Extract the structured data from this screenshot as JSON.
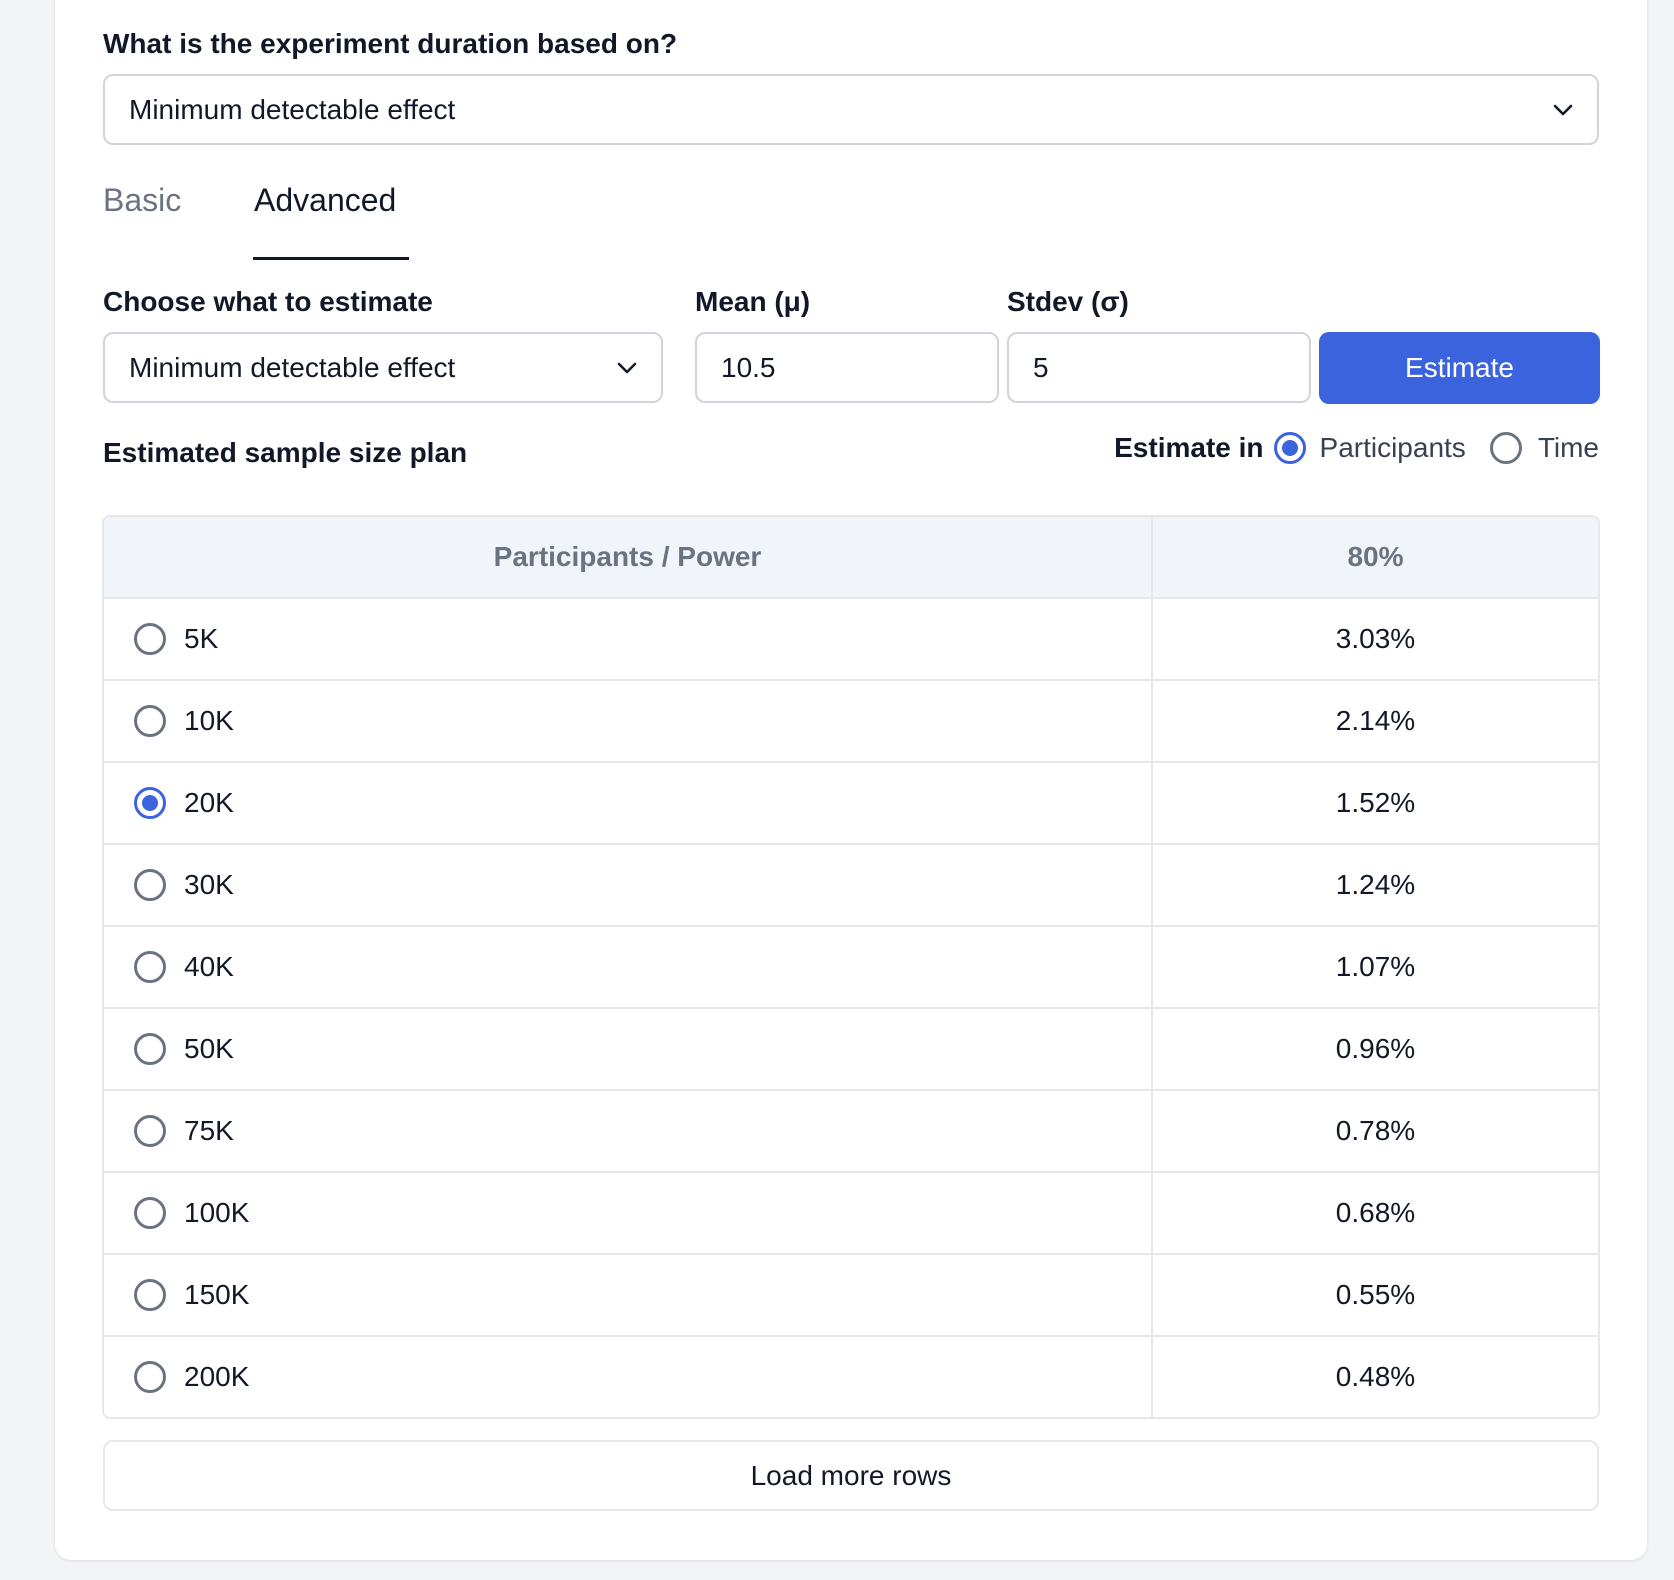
{
  "duration": {
    "label": "What is the experiment duration based on?",
    "selected": "Minimum detectable effect"
  },
  "tabs": [
    {
      "label": "Basic",
      "active": false
    },
    {
      "label": "Advanced",
      "active": true
    }
  ],
  "estimate_form": {
    "choose_label": "Choose what to estimate",
    "choose_selected": "Minimum detectable effect",
    "mean_label": "Mean (μ)",
    "mean_value": "10.5",
    "stdev_label": "Stdev (σ)",
    "stdev_value": "5",
    "estimate_button": "Estimate"
  },
  "plan": {
    "title": "Estimated sample size plan",
    "estimate_in_label": "Estimate in",
    "options": [
      {
        "label": "Participants",
        "selected": true
      },
      {
        "label": "Time",
        "selected": false
      }
    ]
  },
  "table": {
    "headers": [
      "Participants / Power",
      "80%"
    ],
    "rows": [
      {
        "participants": "5K",
        "value": "3.03%",
        "selected": false
      },
      {
        "participants": "10K",
        "value": "2.14%",
        "selected": false
      },
      {
        "participants": "20K",
        "value": "1.52%",
        "selected": true
      },
      {
        "participants": "30K",
        "value": "1.24%",
        "selected": false
      },
      {
        "participants": "40K",
        "value": "1.07%",
        "selected": false
      },
      {
        "participants": "50K",
        "value": "0.96%",
        "selected": false
      },
      {
        "participants": "75K",
        "value": "0.78%",
        "selected": false
      },
      {
        "participants": "100K",
        "value": "0.68%",
        "selected": false
      },
      {
        "participants": "150K",
        "value": "0.55%",
        "selected": false
      },
      {
        "participants": "200K",
        "value": "0.48%",
        "selected": false
      }
    ]
  },
  "load_more": "Load more rows",
  "colors": {
    "accent": "#3b63dd",
    "border": "#d1d5db",
    "table_header_bg": "#f1f4f9",
    "muted_text": "#6b7280"
  }
}
